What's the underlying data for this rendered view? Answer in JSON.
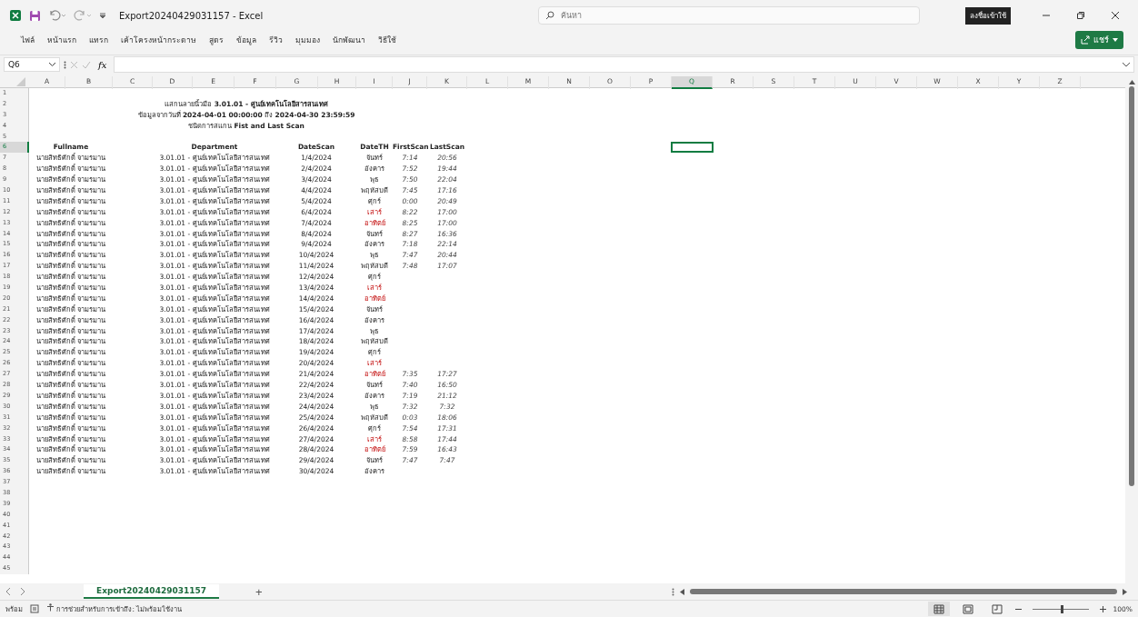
{
  "title_bar": {
    "title": "Export20240429031157  -  Excel",
    "search_placeholder": "ค้นหา",
    "sign_in": "ลงชื่อเข้าใช้"
  },
  "menu": [
    "ไฟล์",
    "หน้าแรก",
    "แทรก",
    "เค้าโครงหน้ากระดาษ",
    "สูตร",
    "ข้อมูล",
    "รีวิว",
    "มุมมอง",
    "นักพัฒนา",
    "วิธีใช้"
  ],
  "share_button": "แชร์",
  "formula_bar": {
    "name_box": "Q6",
    "function_label": "fx"
  },
  "column_headers": [
    {
      "label": "A",
      "selected": false
    },
    {
      "label": "B",
      "selected": false
    },
    {
      "label": "C",
      "selected": false
    },
    {
      "label": "D",
      "selected": false
    },
    {
      "label": "E",
      "selected": false
    },
    {
      "label": "F",
      "selected": false
    },
    {
      "label": "G",
      "selected": false
    },
    {
      "label": "H",
      "selected": false
    },
    {
      "label": "I",
      "selected": false
    },
    {
      "label": "J",
      "selected": false
    },
    {
      "label": "K",
      "selected": false
    },
    {
      "label": "L",
      "selected": false
    },
    {
      "label": "M",
      "selected": false
    },
    {
      "label": "N",
      "selected": false
    },
    {
      "label": "O",
      "selected": false
    },
    {
      "label": "P",
      "selected": false
    },
    {
      "label": "Q",
      "selected": true
    },
    {
      "label": "R",
      "selected": false
    },
    {
      "label": "S",
      "selected": false
    },
    {
      "label": "T",
      "selected": false
    },
    {
      "label": "U",
      "selected": false
    },
    {
      "label": "V",
      "selected": false
    },
    {
      "label": "W",
      "selected": false
    },
    {
      "label": "X",
      "selected": false
    },
    {
      "label": "Y",
      "selected": false
    },
    {
      "label": "Z",
      "selected": false
    }
  ],
  "row_headers": [
    {
      "label": "1",
      "selected": false
    },
    {
      "label": "2",
      "selected": false
    },
    {
      "label": "3",
      "selected": false
    },
    {
      "label": "4",
      "selected": false
    },
    {
      "label": "5",
      "selected": false
    },
    {
      "label": "6",
      "selected": true
    },
    {
      "label": "7",
      "selected": false
    },
    {
      "label": "8",
      "selected": false
    },
    {
      "label": "9",
      "selected": false
    },
    {
      "label": "10",
      "selected": false
    },
    {
      "label": "11",
      "selected": false
    },
    {
      "label": "12",
      "selected": false
    },
    {
      "label": "13",
      "selected": false
    },
    {
      "label": "14",
      "selected": false
    },
    {
      "label": "15",
      "selected": false
    },
    {
      "label": "16",
      "selected": false
    },
    {
      "label": "17",
      "selected": false
    },
    {
      "label": "18",
      "selected": false
    },
    {
      "label": "19",
      "selected": false
    },
    {
      "label": "20",
      "selected": false
    },
    {
      "label": "21",
      "selected": false
    },
    {
      "label": "22",
      "selected": false
    },
    {
      "label": "23",
      "selected": false
    },
    {
      "label": "24",
      "selected": false
    },
    {
      "label": "25",
      "selected": false
    },
    {
      "label": "26",
      "selected": false
    },
    {
      "label": "27",
      "selected": false
    },
    {
      "label": "28",
      "selected": false
    },
    {
      "label": "29",
      "selected": false
    },
    {
      "label": "30",
      "selected": false
    },
    {
      "label": "31",
      "selected": false
    },
    {
      "label": "32",
      "selected": false
    },
    {
      "label": "33",
      "selected": false
    },
    {
      "label": "34",
      "selected": false
    },
    {
      "label": "35",
      "selected": false
    },
    {
      "label": "36",
      "selected": false
    },
    {
      "label": "37",
      "selected": false
    },
    {
      "label": "38",
      "selected": false
    },
    {
      "label": "39",
      "selected": false
    },
    {
      "label": "40",
      "selected": false
    },
    {
      "label": "41",
      "selected": false
    },
    {
      "label": "42",
      "selected": false
    },
    {
      "label": "43",
      "selected": false
    },
    {
      "label": "44",
      "selected": false
    },
    {
      "label": "45",
      "selected": false
    }
  ],
  "report": {
    "title_lines": [
      "แสกนลายนิ้วมือ **3.01.01 - ศูนย์เทคโนโลยีสารสนเทศ**",
      "ข้อมูลจากวันที่ **2024-04-01 00:00:00** ถึง **2024-04-30 23:59:59**",
      "ชนิดการสแกน **Fist and Last Scan**"
    ],
    "columns": [
      "Fullname",
      "Department",
      "DateScan",
      "DateTH",
      "FirstScan",
      "LastScan"
    ],
    "rows": [
      {
        "fullname": "นายสิทธิศักดิ์ จามรมาน",
        "department": "3.01.01 - ศูนย์เทคโนโลยีสารสนเทศ",
        "date": "1/4/2024",
        "day": "จันทร์",
        "weekend": false,
        "first": "7:14",
        "last": "20:56"
      },
      {
        "fullname": "นายสิทธิศักดิ์ จามรมาน",
        "department": "3.01.01 - ศูนย์เทคโนโลยีสารสนเทศ",
        "date": "2/4/2024",
        "day": "อังคาร",
        "weekend": false,
        "first": "7:52",
        "last": "19:44"
      },
      {
        "fullname": "นายสิทธิศักดิ์ จามรมาน",
        "department": "3.01.01 - ศูนย์เทคโนโลยีสารสนเทศ",
        "date": "3/4/2024",
        "day": "พุธ",
        "weekend": false,
        "first": "7:50",
        "last": "22:04"
      },
      {
        "fullname": "นายสิทธิศักดิ์ จามรมาน",
        "department": "3.01.01 - ศูนย์เทคโนโลยีสารสนเทศ",
        "date": "4/4/2024",
        "day": "พฤหัสบดี",
        "weekend": false,
        "first": "7:45",
        "last": "17:16"
      },
      {
        "fullname": "นายสิทธิศักดิ์ จามรมาน",
        "department": "3.01.01 - ศูนย์เทคโนโลยีสารสนเทศ",
        "date": "5/4/2024",
        "day": "ศุกร์",
        "weekend": false,
        "first": "0:00",
        "last": "20:49"
      },
      {
        "fullname": "นายสิทธิศักดิ์ จามรมาน",
        "department": "3.01.01 - ศูนย์เทคโนโลยีสารสนเทศ",
        "date": "6/4/2024",
        "day": "เสาร์",
        "weekend": true,
        "first": "8:22",
        "last": "17:00"
      },
      {
        "fullname": "นายสิทธิศักดิ์ จามรมาน",
        "department": "3.01.01 - ศูนย์เทคโนโลยีสารสนเทศ",
        "date": "7/4/2024",
        "day": "อาทิตย์",
        "weekend": true,
        "first": "8:25",
        "last": "17:00"
      },
      {
        "fullname": "นายสิทธิศักดิ์ จามรมาน",
        "department": "3.01.01 - ศูนย์เทคโนโลยีสารสนเทศ",
        "date": "8/4/2024",
        "day": "จันทร์",
        "weekend": false,
        "first": "8:27",
        "last": "16:36"
      },
      {
        "fullname": "นายสิทธิศักดิ์ จามรมาน",
        "department": "3.01.01 - ศูนย์เทคโนโลยีสารสนเทศ",
        "date": "9/4/2024",
        "day": "อังคาร",
        "weekend": false,
        "first": "7:18",
        "last": "22:14"
      },
      {
        "fullname": "นายสิทธิศักดิ์ จามรมาน",
        "department": "3.01.01 - ศูนย์เทคโนโลยีสารสนเทศ",
        "date": "10/4/2024",
        "day": "พุธ",
        "weekend": false,
        "first": "7:47",
        "last": "20:44"
      },
      {
        "fullname": "นายสิทธิศักดิ์ จามรมาน",
        "department": "3.01.01 - ศูนย์เทคโนโลยีสารสนเทศ",
        "date": "11/4/2024",
        "day": "พฤหัสบดี",
        "weekend": false,
        "first": "7:48",
        "last": "17:07"
      },
      {
        "fullname": "นายสิทธิศักดิ์ จามรมาน",
        "department": "3.01.01 - ศูนย์เทคโนโลยีสารสนเทศ",
        "date": "12/4/2024",
        "day": "ศุกร์",
        "weekend": false
      },
      {
        "fullname": "นายสิทธิศักดิ์ จามรมาน",
        "department": "3.01.01 - ศูนย์เทคโนโลยีสารสนเทศ",
        "date": "13/4/2024",
        "day": "เสาร์",
        "weekend": true
      },
      {
        "fullname": "นายสิทธิศักดิ์ จามรมาน",
        "department": "3.01.01 - ศูนย์เทคโนโลยีสารสนเทศ",
        "date": "14/4/2024",
        "day": "อาทิตย์",
        "weekend": true
      },
      {
        "fullname": "นายสิทธิศักดิ์ จามรมาน",
        "department": "3.01.01 - ศูนย์เทคโนโลยีสารสนเทศ",
        "date": "15/4/2024",
        "day": "จันทร์",
        "weekend": false
      },
      {
        "fullname": "นายสิทธิศักดิ์ จามรมาน",
        "department": "3.01.01 - ศูนย์เทคโนโลยีสารสนเทศ",
        "date": "16/4/2024",
        "day": "อังคาร",
        "weekend": false
      },
      {
        "fullname": "นายสิทธิศักดิ์ จามรมาน",
        "department": "3.01.01 - ศูนย์เทคโนโลยีสารสนเทศ",
        "date": "17/4/2024",
        "day": "พุธ",
        "weekend": false
      },
      {
        "fullname": "นายสิทธิศักดิ์ จามรมาน",
        "department": "3.01.01 - ศูนย์เทคโนโลยีสารสนเทศ",
        "date": "18/4/2024",
        "day": "พฤหัสบดี",
        "weekend": false
      },
      {
        "fullname": "นายสิทธิศักดิ์ จามรมาน",
        "department": "3.01.01 - ศูนย์เทคโนโลยีสารสนเทศ",
        "date": "19/4/2024",
        "day": "ศุกร์",
        "weekend": false
      },
      {
        "fullname": "นายสิทธิศักดิ์ จามรมาน",
        "department": "3.01.01 - ศูนย์เทคโนโลยีสารสนเทศ",
        "date": "20/4/2024",
        "day": "เสาร์",
        "weekend": true
      },
      {
        "fullname": "นายสิทธิศักดิ์ จามรมาน",
        "department": "3.01.01 - ศูนย์เทคโนโลยีสารสนเทศ",
        "date": "21/4/2024",
        "day": "อาทิตย์",
        "weekend": true,
        "first": "7:35",
        "last": "17:27"
      },
      {
        "fullname": "นายสิทธิศักดิ์ จามรมาน",
        "department": "3.01.01 - ศูนย์เทคโนโลยีสารสนเทศ",
        "date": "22/4/2024",
        "day": "จันทร์",
        "weekend": false,
        "first": "7:40",
        "last": "16:50"
      },
      {
        "fullname": "นายสิทธิศักดิ์ จามรมาน",
        "department": "3.01.01 - ศูนย์เทคโนโลยีสารสนเทศ",
        "date": "23/4/2024",
        "day": "อังคาร",
        "weekend": false,
        "first": "7:19",
        "last": "21:12"
      },
      {
        "fullname": "นายสิทธิศักดิ์ จามรมาน",
        "department": "3.01.01 - ศูนย์เทคโนโลยีสารสนเทศ",
        "date": "24/4/2024",
        "day": "พุธ",
        "weekend": false,
        "first": "7:32",
        "last": "7:32"
      },
      {
        "fullname": "นายสิทธิศักดิ์ จามรมาน",
        "department": "3.01.01 - ศูนย์เทคโนโลยีสารสนเทศ",
        "date": "25/4/2024",
        "day": "พฤหัสบดี",
        "weekend": false,
        "first": "0:03",
        "last": "18:06"
      },
      {
        "fullname": "นายสิทธิศักดิ์ จามรมาน",
        "department": "3.01.01 - ศูนย์เทคโนโลยีสารสนเทศ",
        "date": "26/4/2024",
        "day": "ศุกร์",
        "weekend": false,
        "first": "7:54",
        "last": "17:31"
      },
      {
        "fullname": "นายสิทธิศักดิ์ จามรมาน",
        "department": "3.01.01 - ศูนย์เทคโนโลยีสารสนเทศ",
        "date": "27/4/2024",
        "day": "เสาร์",
        "weekend": true,
        "first": "8:58",
        "last": "17:44"
      },
      {
        "fullname": "นายสิทธิศักดิ์ จามรมาน",
        "department": "3.01.01 - ศูนย์เทคโนโลยีสารสนเทศ",
        "date": "28/4/2024",
        "day": "อาทิตย์",
        "weekend": true,
        "first": "7:59",
        "last": "16:43"
      },
      {
        "fullname": "นายสิทธิศักดิ์ จามรมาน",
        "department": "3.01.01 - ศูนย์เทคโนโลยีสารสนเทศ",
        "date": "29/4/2024",
        "day": "จันทร์",
        "weekend": false,
        "first": "7:47",
        "last": "7:47"
      },
      {
        "fullname": "นายสิทธิศักดิ์ จามรมาน",
        "department": "3.01.01 - ศูนย์เทคโนโลยีสารสนเทศ",
        "date": "30/4/2024",
        "day": "อังคาร",
        "weekend": false
      }
    ]
  },
  "sheet_tabs": [
    {
      "label": "Export20240429031157",
      "selected": true
    }
  ],
  "add_sheet": "+",
  "status_bar": {
    "ready": "พร้อม",
    "accessibility": "การช่วยสำหรับการเข้าถึง: ไม่พร้อมใช้งาน",
    "views": [
      {
        "kind": "normal",
        "selected": true
      },
      {
        "kind": "layout",
        "selected": false
      },
      {
        "kind": "pagebreak",
        "selected": false
      }
    ],
    "level": 0.5,
    "zoom": "100%"
  }
}
